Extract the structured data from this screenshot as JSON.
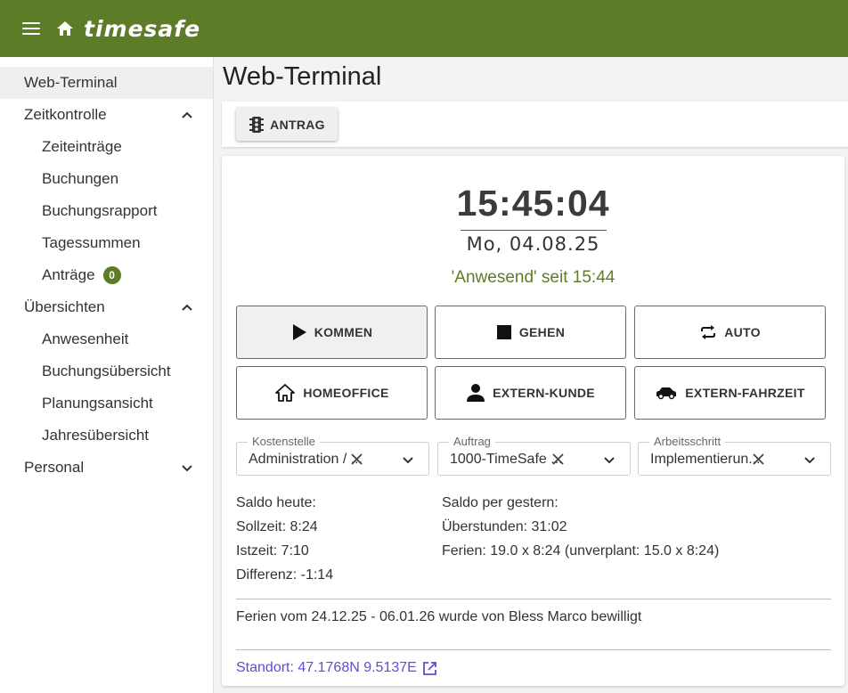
{
  "header": {
    "app_name": "timesafe",
    "menu_icon": "menu-icon",
    "home_icon": "home-icon"
  },
  "sidebar": {
    "web_terminal": "Web-Terminal",
    "zeitkontrolle": "Zeitkontrolle",
    "zeiteintraege": "Zeiteinträge",
    "buchungen": "Buchungen",
    "buchungsrapport": "Buchungsrapport",
    "tagessummen": "Tagessummen",
    "antraege": "Anträge",
    "antraege_badge": "0",
    "uebersichten": "Übersichten",
    "anwesenheit": "Anwesenheit",
    "buchungsuebersicht": "Buchungsübersicht",
    "planungsansicht": "Planungsansicht",
    "jahresuebersicht": "Jahresübersicht",
    "personal": "Personal"
  },
  "page": {
    "title": "Web-Terminal"
  },
  "toolbar": {
    "antrag_label": "ANTRAG"
  },
  "terminal": {
    "time": "15:45:04",
    "date": "Mo, 04.08.25",
    "status": "'Anwesend' seit 15:44",
    "buttons": {
      "kommen": "KOMMEN",
      "gehen": "GEHEN",
      "auto": "AUTO",
      "homeoffice": "HOMEOFFICE",
      "extern_kunde": "EXTERN-KUNDE",
      "extern_fahrzeit": "EXTERN-FAHRZEIT"
    },
    "fields": {
      "kostenstelle": {
        "label": "Kostenstelle",
        "value": "Administration / ..."
      },
      "auftrag": {
        "label": "Auftrag",
        "value": "1000-TimeSafe ..."
      },
      "arbeitsschritt": {
        "label": "Arbeitsschritt",
        "value": "Implementierun..."
      }
    },
    "saldo_heute": {
      "title": "Saldo heute:",
      "sollzeit": "Sollzeit: 8:24",
      "istzeit": "Istzeit: 7:10",
      "differenz": "Differenz: -1:14"
    },
    "saldo_gestern": {
      "title": "Saldo per gestern:",
      "ueberstunden": "Überstunden: 31:02",
      "ferien": "Ferien: 19.0 x 8:24 (unverplant: 15.0 x 8:24)"
    },
    "notice": "Ferien vom 24.12.25 - 06.01.26 wurde von Bless Marco bewilligt",
    "location": "Standort: 47.1768N 9.5137E"
  },
  "colors": {
    "brand": "#5d7c27",
    "link": "#5b4fd6"
  }
}
